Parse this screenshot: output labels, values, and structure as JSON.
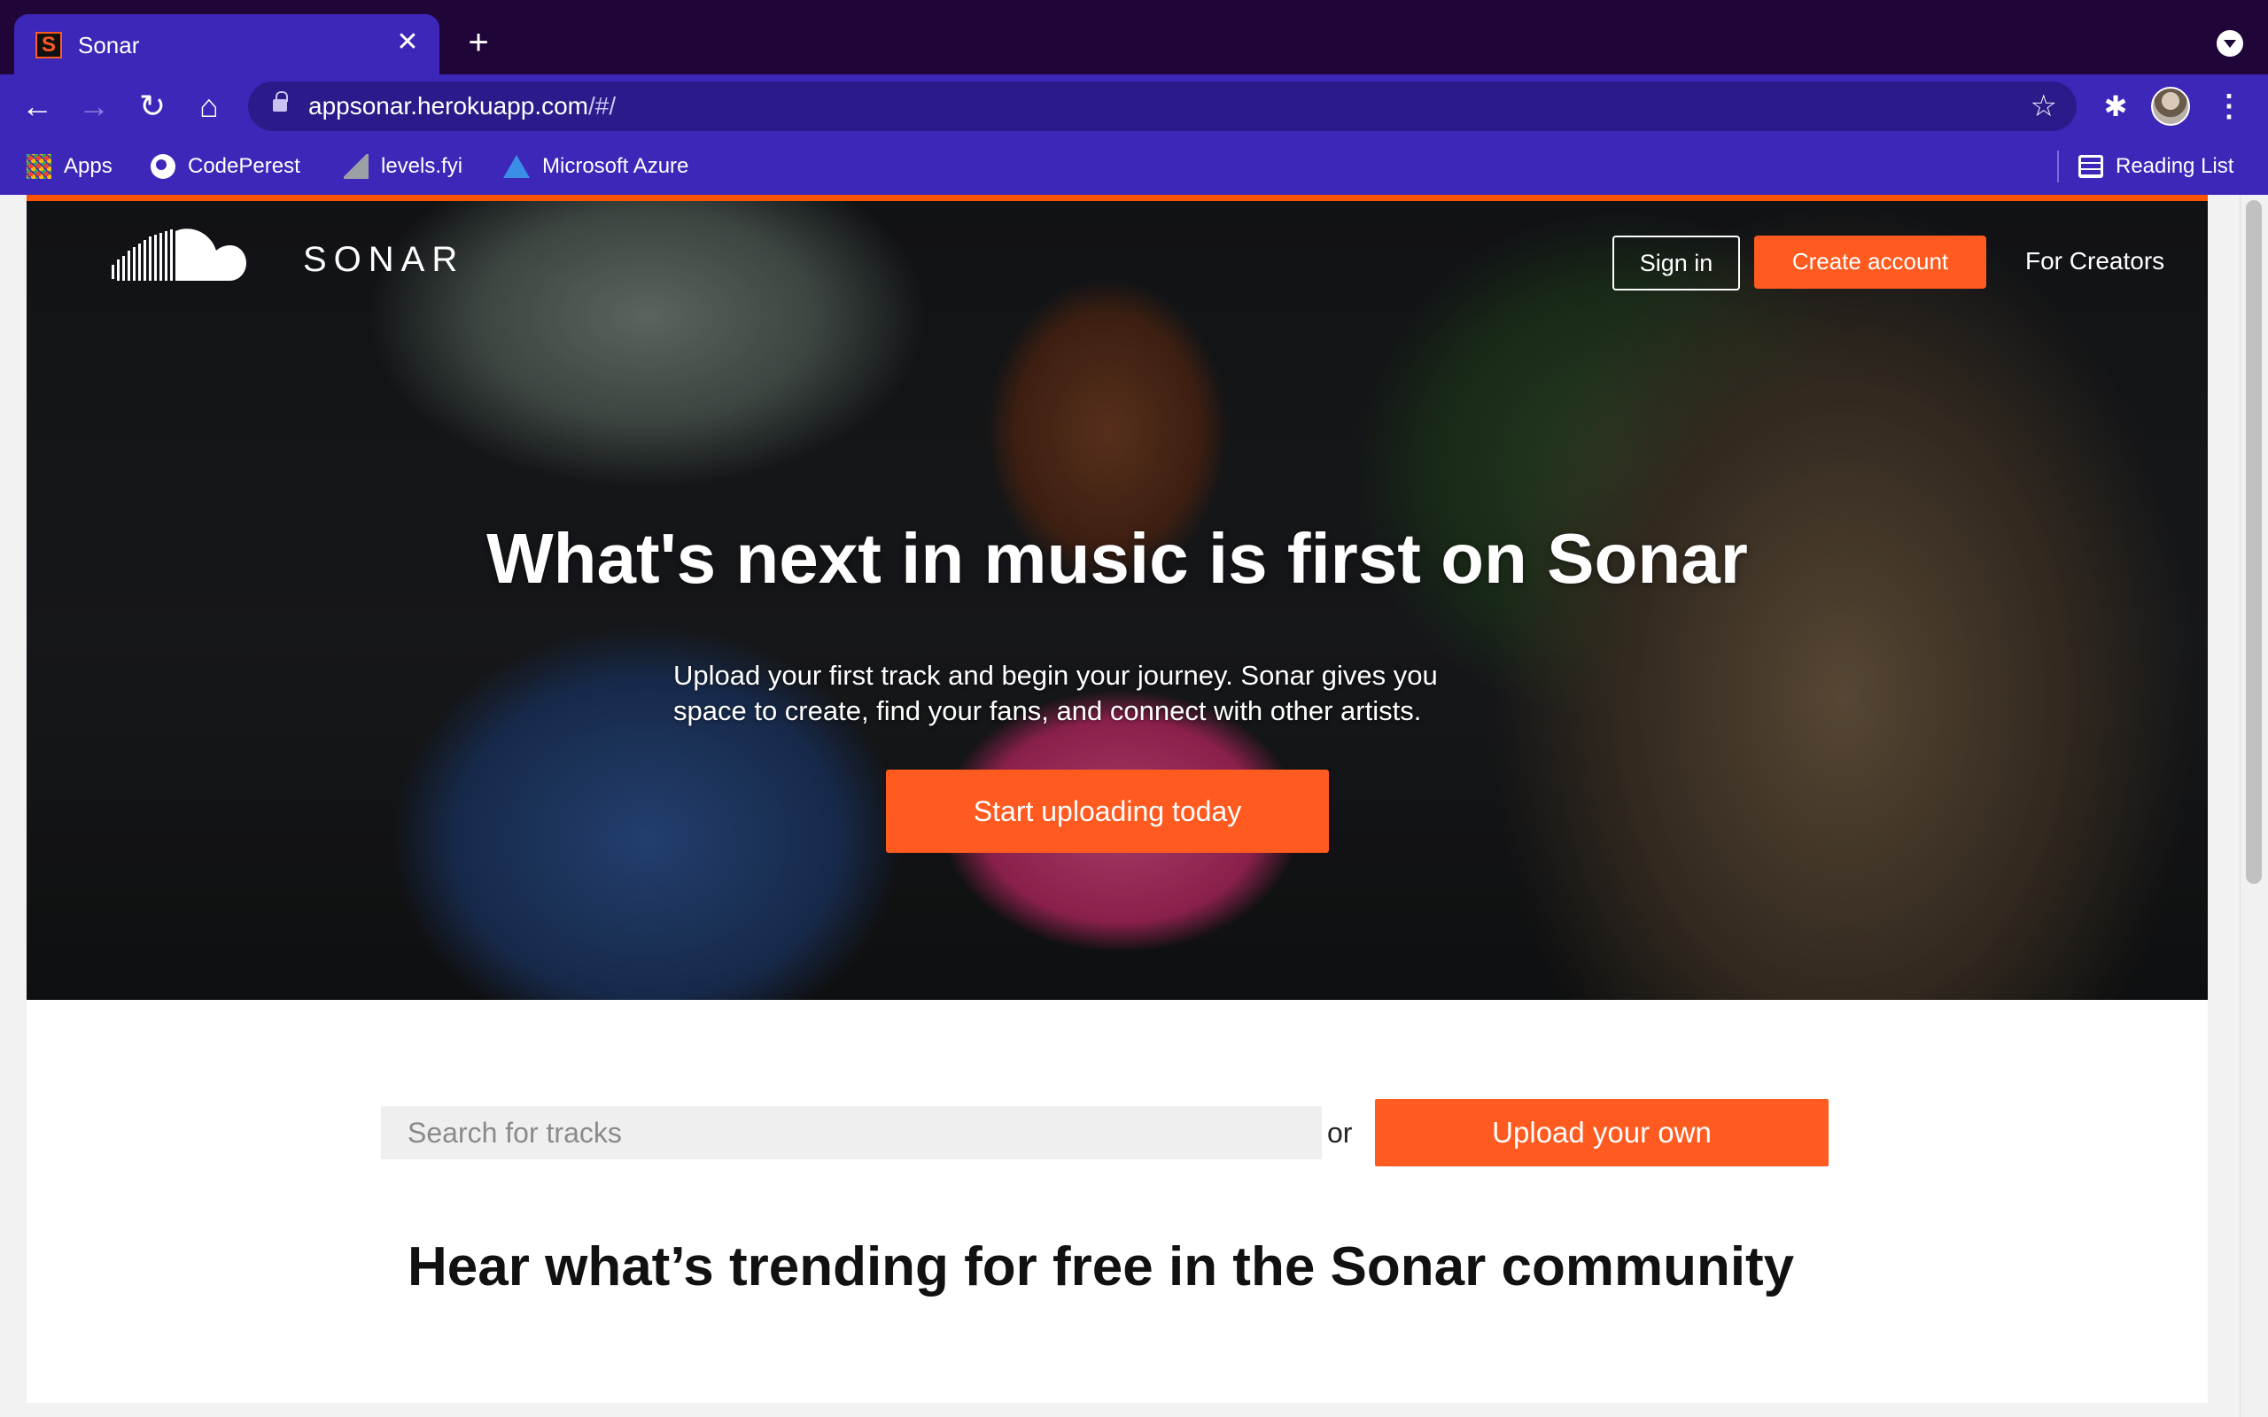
{
  "browser": {
    "tab": {
      "title": "Sonar",
      "favicon": "S",
      "close": "✕"
    },
    "new_tab": "+",
    "url": {
      "host": "appsonar.herokuapp.com",
      "path": "/#/"
    },
    "nav": {
      "back": "←",
      "forward": "→",
      "reload": "↻",
      "home": "⌂"
    },
    "star": "☆",
    "extensions": "✱",
    "menu": "⋮",
    "bookmarks": [
      {
        "label": "Apps",
        "icon": "apps-grid-icon"
      },
      {
        "label": "CodePerest",
        "icon": "globe-icon"
      },
      {
        "label": "levels.fyi",
        "icon": "levels-icon"
      },
      {
        "label": "Microsoft Azure",
        "icon": "azure-icon"
      }
    ],
    "reading_list": "Reading List"
  },
  "header": {
    "brand": "SONAR",
    "sign_in": "Sign in",
    "create_account": "Create account",
    "for_creators": "For Creators"
  },
  "hero": {
    "title": "What's next in music is first on Sonar",
    "subtitle_line1": "Upload your first track and begin your journey. Sonar gives you",
    "subtitle_line2": "space to create, find your fans, and connect with other artists.",
    "cta": "Start uploading today"
  },
  "search": {
    "placeholder": "Search for tracks",
    "or": "or",
    "upload": "Upload your own"
  },
  "trending": {
    "heading": "Hear what’s trending for free in the Sonar community"
  },
  "colors": {
    "accent": "#ff5a1f",
    "chrome": "#3d27b9",
    "tabbar": "#1f0538"
  }
}
